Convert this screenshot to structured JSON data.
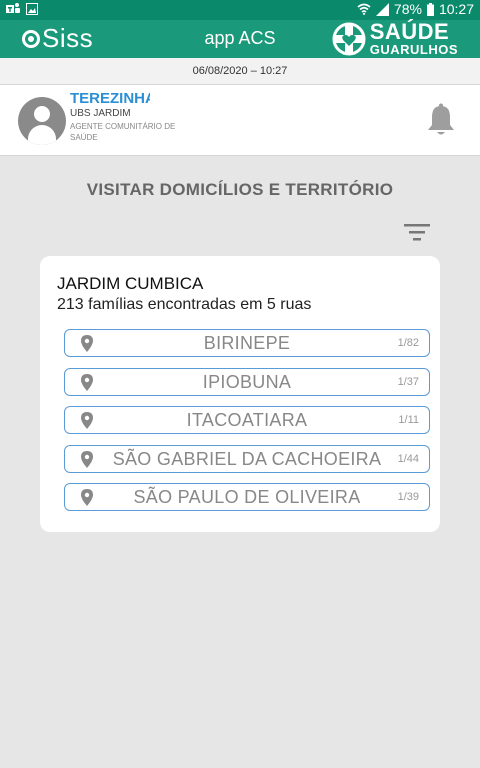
{
  "status_bar": {
    "battery": "78%",
    "time": "10:27"
  },
  "app_bar": {
    "logo": "Siss",
    "title": "app ACS",
    "brand_main": "SAÚDE",
    "brand_sub": "GUARULHOS"
  },
  "date_line": "06/08/2020 – 10:27",
  "profile": {
    "name": "TEREZINHA",
    "unit": "UBS JARDIM",
    "role": "AGENTE COMUNITÁRIO DE SAÚDE"
  },
  "section_title": "VISITAR DOMICÍLIOS E TERRITÓRIO",
  "card": {
    "title": "JARDIM CUMBICA",
    "subtitle": "213 famílias encontradas em 5 ruas",
    "streets": [
      {
        "name": "BIRINEPE",
        "count": "1/82"
      },
      {
        "name": "IPIOBUNA",
        "count": "1/37"
      },
      {
        "name": "ITACOATIARA",
        "count": "1/11"
      },
      {
        "name": "SÃO GABRIEL DA CACHOEIRA",
        "count": "1/44"
      },
      {
        "name": "SÃO PAULO DE OLIVEIRA",
        "count": "1/39"
      }
    ]
  },
  "colors": {
    "primary": "#1a9a7a",
    "status_bar": "#0b8a6b",
    "accent_blue": "#2a8fd6",
    "street_border": "#5b9bd5"
  },
  "icons": [
    "teams-icon",
    "image-icon",
    "wifi-icon",
    "signal-icon",
    "battery-icon",
    "bell-icon",
    "filter-icon",
    "location-pin-icon"
  ]
}
